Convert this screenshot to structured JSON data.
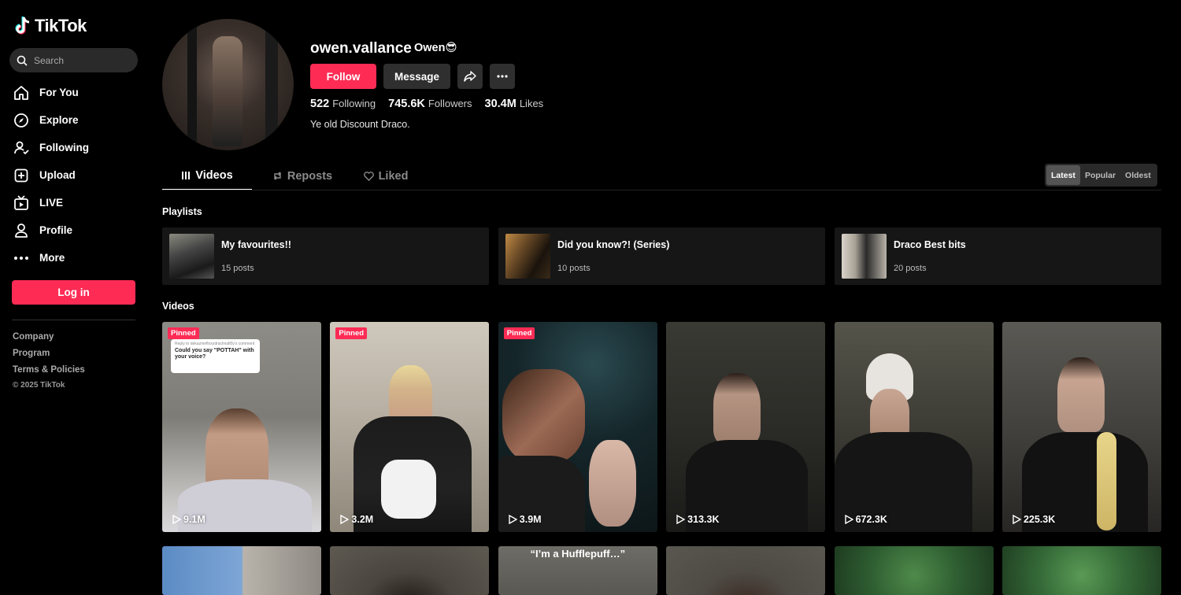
{
  "app": {
    "brand": "TikTok",
    "accent": "#fe2c55"
  },
  "search": {
    "placeholder": "Search"
  },
  "nav": [
    {
      "label": "For You",
      "icon": "home-icon"
    },
    {
      "label": "Explore",
      "icon": "compass-icon"
    },
    {
      "label": "Following",
      "icon": "user-follow-icon"
    },
    {
      "label": "Upload",
      "icon": "plus-square-icon"
    },
    {
      "label": "LIVE",
      "icon": "live-tv-icon"
    },
    {
      "label": "Profile",
      "icon": "person-icon"
    },
    {
      "label": "More",
      "icon": "more-dots-icon"
    }
  ],
  "login_label": "Log in",
  "footer": {
    "links": [
      "Company",
      "Program",
      "Terms & Policies"
    ],
    "copyright": "© 2025 TikTok"
  },
  "profile": {
    "username": "owen.vallance",
    "nickname": "Owen😎",
    "follow_label": "Follow",
    "message_label": "Message",
    "stats": [
      {
        "value": "522",
        "label": "Following"
      },
      {
        "value": "745.6K",
        "label": "Followers"
      },
      {
        "value": "30.4M",
        "label": "Likes"
      }
    ],
    "bio": "Ye old Discount Draco."
  },
  "tabs": [
    {
      "label": "Videos",
      "icon": "grid-icon",
      "active": true
    },
    {
      "label": "Reposts",
      "icon": "repost-icon",
      "active": false
    },
    {
      "label": "Liked",
      "icon": "heart-icon",
      "active": false
    }
  ],
  "sort": {
    "options": [
      "Latest",
      "Popular",
      "Oldest"
    ],
    "selected": "Latest"
  },
  "playlists_title": "Playlists",
  "playlists": [
    {
      "title": "My favourites!!",
      "count": "15 posts"
    },
    {
      "title": "Did you know?! (Series)",
      "count": "10 posts"
    },
    {
      "title": "Draco Best bits",
      "count": "20 posts"
    }
  ],
  "videos_title": "Videos",
  "videos": [
    {
      "views": "9.1M",
      "pinned": "Pinned",
      "reply": "Reply to dekazmefloxydraclmalf0y's comment",
      "caption": "Could you say \"POTTAH\" with your voice?"
    },
    {
      "views": "3.2M",
      "pinned": "Pinned"
    },
    {
      "views": "3.9M",
      "pinned": "Pinned"
    },
    {
      "views": "313.3K"
    },
    {
      "views": "672.3K"
    },
    {
      "views": "225.3K"
    }
  ],
  "videos_row2": [
    {},
    {},
    {
      "overlay": "“I’m a Hufflepuff…”"
    },
    {},
    {},
    {}
  ]
}
